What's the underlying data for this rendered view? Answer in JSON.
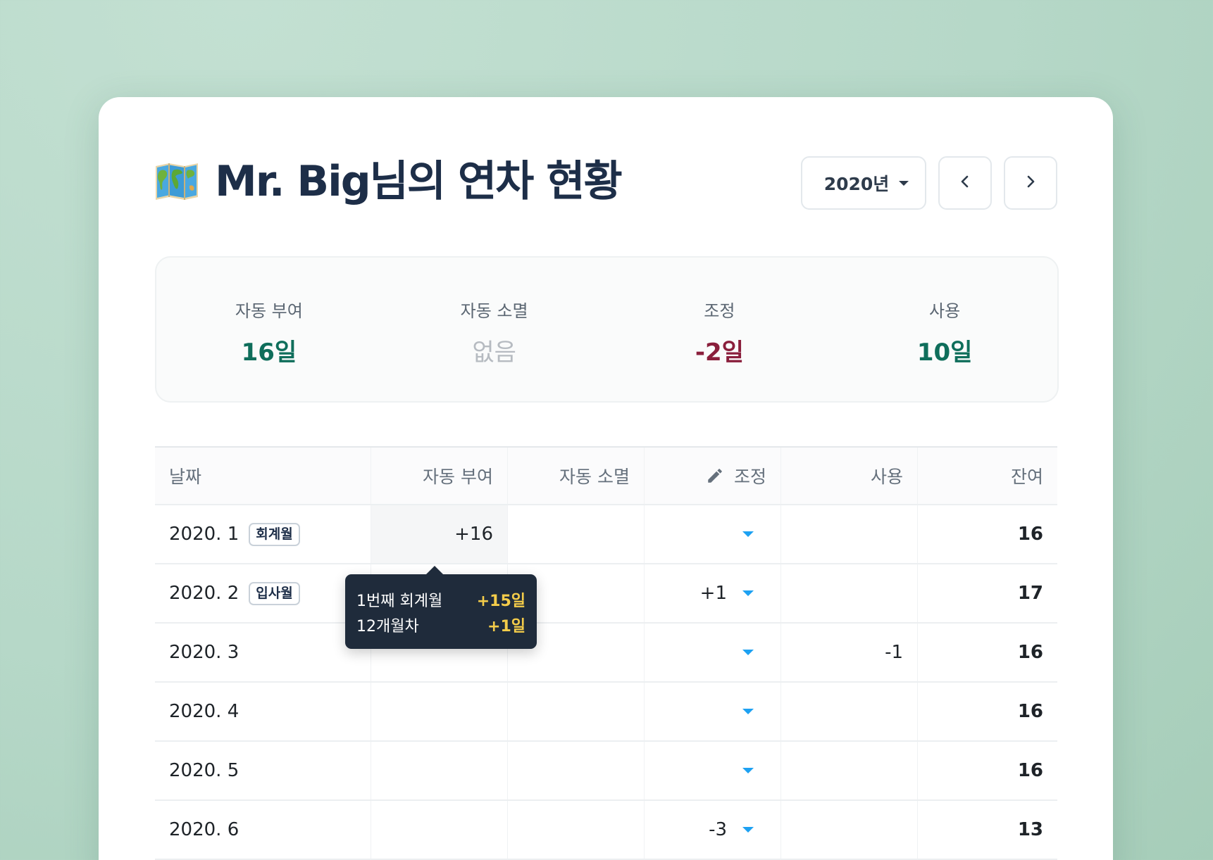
{
  "header": {
    "title": "Mr. Big님의 연차 현황",
    "icon": "world-map-icon",
    "year_select": "2020년",
    "prev_icon": "chevron-left-icon",
    "next_icon": "chevron-right-icon"
  },
  "summary": [
    {
      "label": "자동 부여",
      "value": "16일"
    },
    {
      "label": "자동 소멸",
      "value": "없음"
    },
    {
      "label": "조정",
      "value": "-2일"
    },
    {
      "label": "사용",
      "value": "10일"
    }
  ],
  "colors": {
    "green": "#0f6e5b",
    "red": "#8a1f3c",
    "navy": "#1d2e48",
    "accent_blue": "#1da1f2",
    "tooltip_yellow": "#f4cc4a"
  },
  "table": {
    "headers": {
      "date": "날짜",
      "auto_grant": "자동 부여",
      "auto_expire": "자동 소멸",
      "adjust": "조정",
      "used": "사용",
      "remain": "잔여"
    },
    "rows": [
      {
        "date": "2020. 1",
        "badge": "회계월",
        "auto_grant": "+16",
        "auto_expire": "",
        "adjust": "",
        "used": "",
        "remain": "16"
      },
      {
        "date": "2020. 2",
        "badge": "입사월",
        "auto_grant": "",
        "auto_expire": "",
        "adjust": "+1",
        "used": "",
        "remain": "17"
      },
      {
        "date": "2020. 3",
        "badge": "",
        "auto_grant": "",
        "auto_expire": "",
        "adjust": "",
        "used": "-1",
        "remain": "16"
      },
      {
        "date": "2020. 4",
        "badge": "",
        "auto_grant": "",
        "auto_expire": "",
        "adjust": "",
        "used": "",
        "remain": "16"
      },
      {
        "date": "2020. 5",
        "badge": "",
        "auto_grant": "",
        "auto_expire": "",
        "adjust": "",
        "used": "",
        "remain": "16"
      },
      {
        "date": "2020. 6",
        "badge": "",
        "auto_grant": "",
        "auto_expire": "",
        "adjust": "-3",
        "used": "",
        "remain": "13"
      }
    ]
  },
  "tooltip": {
    "rows": [
      {
        "label": "1번째 회계월",
        "value": "+15일"
      },
      {
        "label": "12개월차",
        "value": "+1일"
      }
    ]
  }
}
